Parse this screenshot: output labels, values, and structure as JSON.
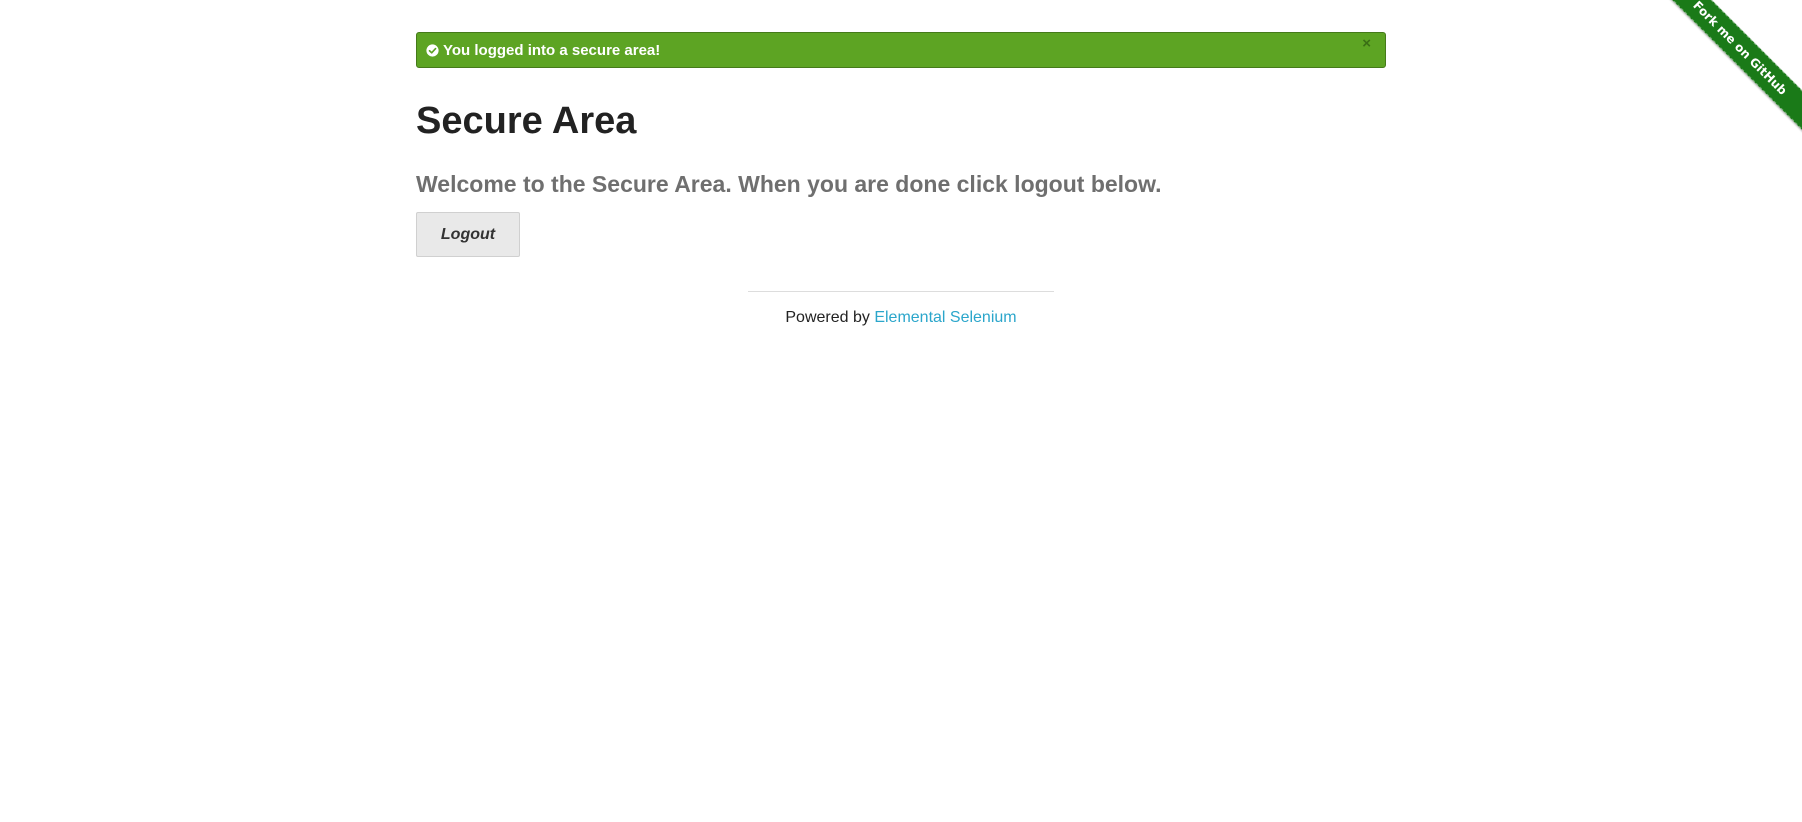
{
  "flash": {
    "message": "You logged into a secure area!",
    "close_symbol": "×",
    "icon": "check-circle-icon",
    "color": "#5da423"
  },
  "main": {
    "title": "Secure Area",
    "subheader": "Welcome to the Secure Area. When you are done click logout below.",
    "logout_label": "Logout"
  },
  "footer": {
    "prefix": "Powered by ",
    "link_text": "Elemental Selenium",
    "link_color": "#2ba6cb"
  },
  "ribbon": {
    "label": "Fork me on GitHub",
    "color": "#1a7a18"
  }
}
